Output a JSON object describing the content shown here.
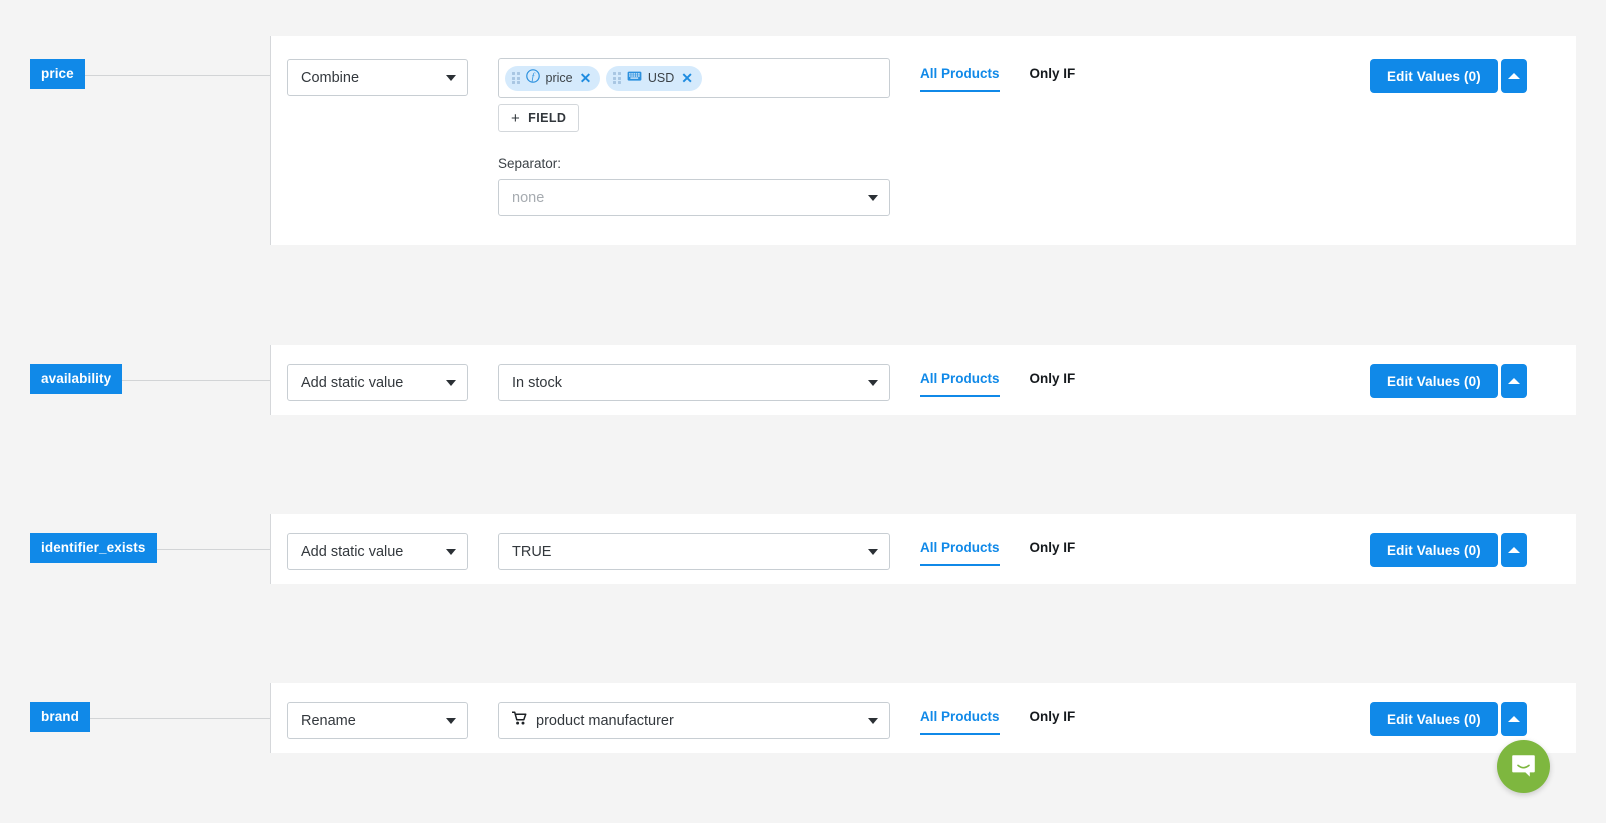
{
  "rows": [
    {
      "label": "price",
      "operation": "Combine",
      "value_type": "chips",
      "chips": [
        {
          "icon": "formula-icon",
          "label": "price"
        },
        {
          "icon": "keyboard-icon",
          "label": "USD"
        }
      ],
      "add_field_label": "FIELD",
      "separator_label": "Separator:",
      "separator_value": "none",
      "separator_is_placeholder": true,
      "tabs": [
        {
          "label": "All Products",
          "active": true
        },
        {
          "label": "Only IF",
          "active": false
        }
      ],
      "edit_values_label": "Edit Values (0)",
      "collapse_icon": "chevron-up-icon"
    },
    {
      "label": "availability",
      "operation": "Add static value",
      "value_type": "select",
      "value": "In stock",
      "value_icon": null,
      "tabs": [
        {
          "label": "All Products",
          "active": true
        },
        {
          "label": "Only IF",
          "active": false
        }
      ],
      "edit_values_label": "Edit Values (0)",
      "collapse_icon": "chevron-up-icon"
    },
    {
      "label": "identifier_exists",
      "operation": "Add static value",
      "value_type": "select",
      "value": "TRUE",
      "value_icon": null,
      "tabs": [
        {
          "label": "All Products",
          "active": true
        },
        {
          "label": "Only IF",
          "active": false
        }
      ],
      "edit_values_label": "Edit Values (0)",
      "collapse_icon": "chevron-up-icon"
    },
    {
      "label": "brand",
      "operation": "Rename",
      "value_type": "select",
      "value": "product manufacturer",
      "value_icon": "shopping-cart-icon",
      "tabs": [
        {
          "label": "All Products",
          "active": true
        },
        {
          "label": "Only IF",
          "active": false
        }
      ],
      "edit_values_label": "Edit Values (0)",
      "collapse_icon": "chevron-up-icon"
    }
  ],
  "chat_widget": {
    "icon": "chat-bubble-icon",
    "color": "#7eb73f"
  },
  "colors": {
    "accent": "#1089e8",
    "background": "#f4f4f4",
    "card": "#ffffff",
    "chip": "#d5eafc",
    "chat": "#7eb73f"
  }
}
